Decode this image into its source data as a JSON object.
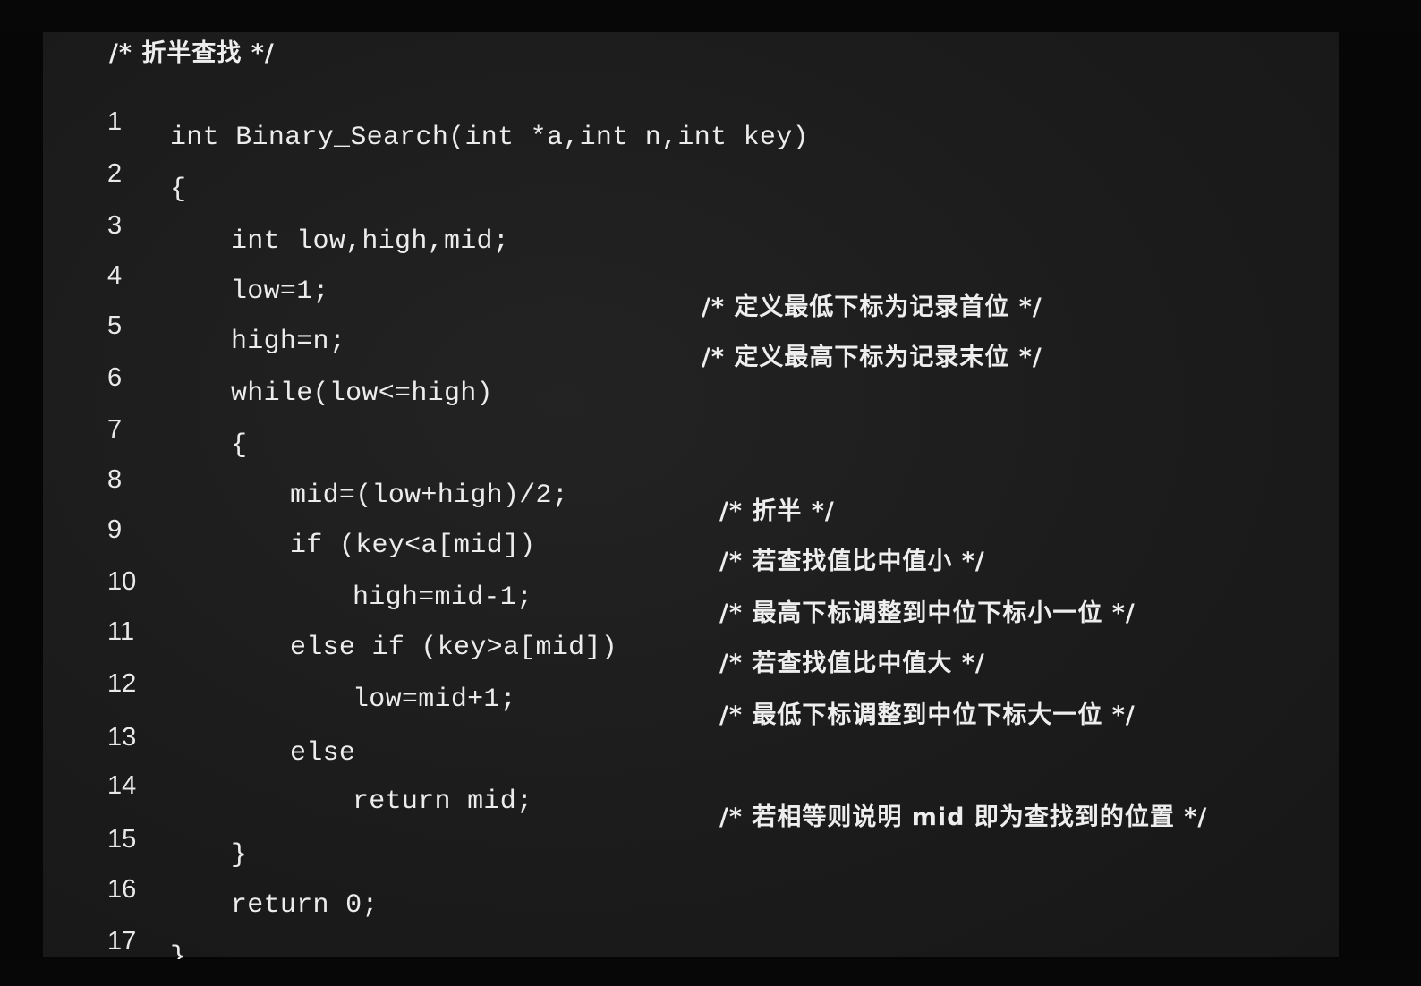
{
  "header_comment": "/* 折半查找 */",
  "lines": [
    {
      "num": "1",
      "code": "int Binary_Search(int *a,int n,int key)",
      "comment": ""
    },
    {
      "num": "2",
      "code": "{",
      "comment": ""
    },
    {
      "num": "3",
      "code": "int low,high,mid;",
      "comment": ""
    },
    {
      "num": "4",
      "code": "low=1;",
      "comment": "/* 定义最低下标为记录首位 */"
    },
    {
      "num": "5",
      "code": "high=n;",
      "comment": "/* 定义最高下标为记录末位 */"
    },
    {
      "num": "6",
      "code": "while(low<=high)",
      "comment": ""
    },
    {
      "num": "7",
      "code": "{",
      "comment": ""
    },
    {
      "num": "8",
      "code": "mid=(low+high)/2;",
      "comment": "/* 折半 */"
    },
    {
      "num": "9",
      "code": "if (key<a[mid])",
      "comment": "/* 若查找值比中值小 */"
    },
    {
      "num": "10",
      "code": "high=mid-1;",
      "comment": "/* 最高下标调整到中位下标小一位 */"
    },
    {
      "num": "11",
      "code": "else if (key>a[mid])",
      "comment": "/* 若查找值比中值大 */"
    },
    {
      "num": "12",
      "code": "low=mid+1;",
      "comment": "/* 最低下标调整到中位下标大一位 */"
    },
    {
      "num": "13",
      "code": "else",
      "comment": ""
    },
    {
      "num": "14",
      "code": "return mid;",
      "comment": "/* 若相等则说明 mid 即为查找到的位置 */"
    },
    {
      "num": "15",
      "code": "}",
      "comment": ""
    },
    {
      "num": "16",
      "code": "return 0;",
      "comment": ""
    },
    {
      "num": "17",
      "code": "}",
      "comment": ""
    }
  ]
}
